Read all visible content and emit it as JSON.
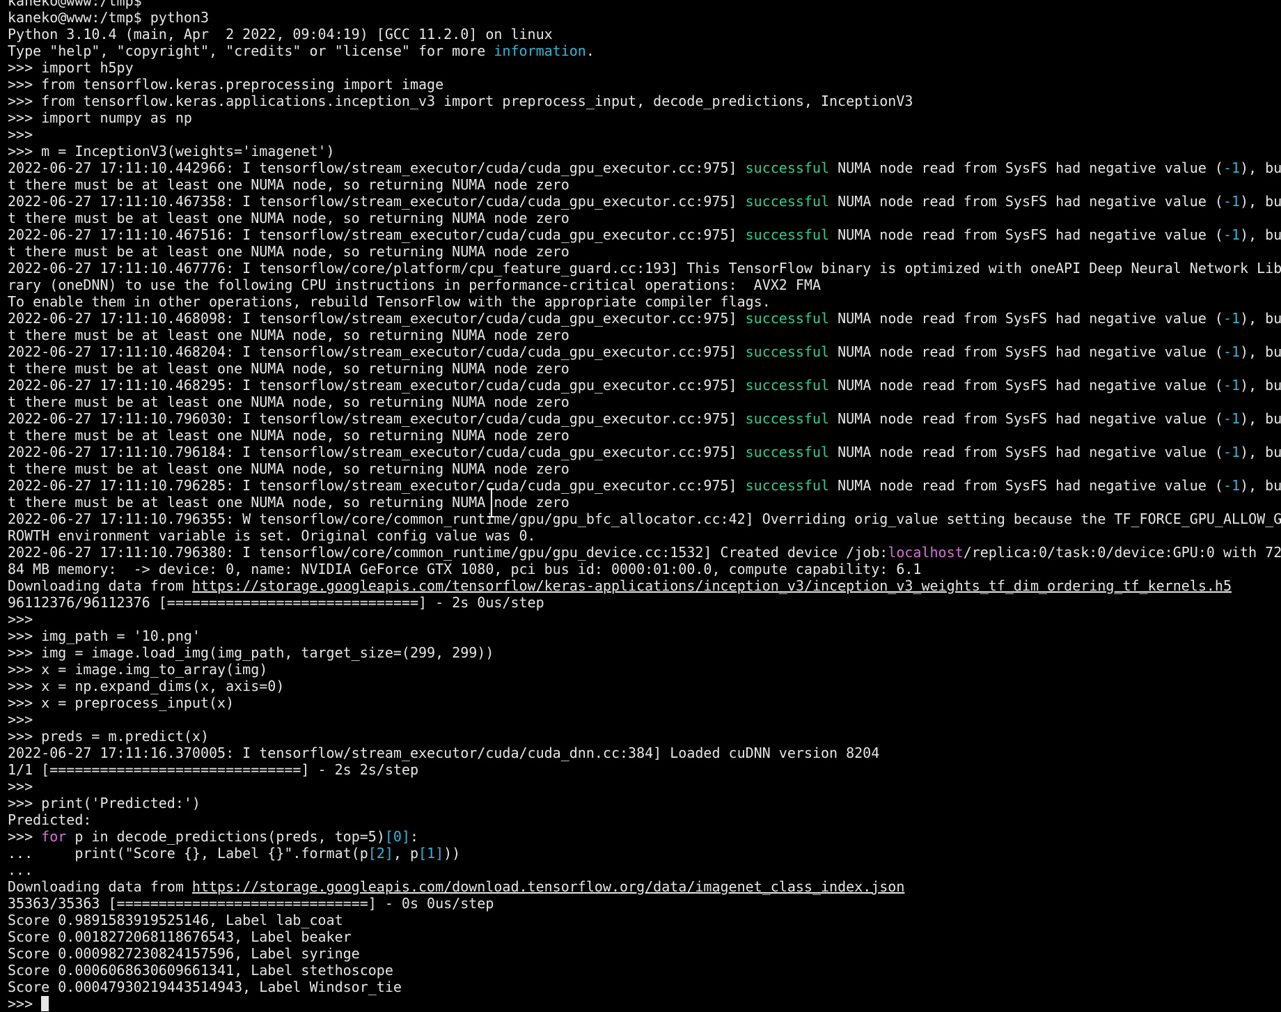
{
  "terminal": {
    "colors": {
      "background": "#000000",
      "text": "#e6e6e6",
      "success": "#23d18b",
      "number": "#29b8db",
      "keyword": "#d670d6"
    },
    "lines": [
      [
        {
          "t": "kaneko@www:/tmp$"
        }
      ],
      [
        {
          "t": "kaneko@www:/tmp$ python3"
        }
      ],
      [
        {
          "t": "Python 3.10.4 (main, Apr  2 2022, 09:04:19) [GCC 11.2.0] on linux"
        }
      ],
      [
        {
          "t": "Type \"help\", \"copyright\", \"credits\" or \"license\" for more "
        },
        {
          "t": "information",
          "s": "cyan"
        },
        {
          "t": "."
        }
      ],
      [
        {
          "t": ">>> import h5py"
        }
      ],
      [
        {
          "t": ">>> from tensorflow.keras.preprocessing import image"
        }
      ],
      [
        {
          "t": ">>> from tensorflow.keras.applications.inception_v3 import preprocess_input, decode_predictions, InceptionV3"
        }
      ],
      [
        {
          "t": ">>> import numpy as np"
        }
      ],
      [
        {
          "t": ">>>"
        }
      ],
      [
        {
          "t": ">>> m = InceptionV3(weights='imagenet')"
        }
      ],
      [
        {
          "t": "2022-06-27 17:11:10.442966: I tensorflow/stream_executor/cuda/cuda_gpu_executor.cc:975] "
        },
        {
          "t": "successful",
          "s": "green"
        },
        {
          "t": " NUMA node read from SysFS had negative value ("
        },
        {
          "t": "-1",
          "s": "cyan"
        },
        {
          "t": "), bu"
        }
      ],
      [
        {
          "t": "t there must be at least one NUMA node, so returning NUMA node zero"
        }
      ],
      [
        {
          "t": "2022-06-27 17:11:10.467358: I tensorflow/stream_executor/cuda/cuda_gpu_executor.cc:975] "
        },
        {
          "t": "successful",
          "s": "green"
        },
        {
          "t": " NUMA node read from SysFS had negative value ("
        },
        {
          "t": "-1",
          "s": "cyan"
        },
        {
          "t": "), bu"
        }
      ],
      [
        {
          "t": "t there must be at least one NUMA node, so returning NUMA node zero"
        }
      ],
      [
        {
          "t": "2022-06-27 17:11:10.467516: I tensorflow/stream_executor/cuda/cuda_gpu_executor.cc:975] "
        },
        {
          "t": "successful",
          "s": "green"
        },
        {
          "t": " NUMA node read from SysFS had negative value ("
        },
        {
          "t": "-1",
          "s": "cyan"
        },
        {
          "t": "), bu"
        }
      ],
      [
        {
          "t": "t there must be at least one NUMA node, so returning NUMA node zero"
        }
      ],
      [
        {
          "t": "2022-06-27 17:11:10.467776: I tensorflow/core/platform/cpu_feature_guard.cc:193] This TensorFlow binary is optimized with oneAPI Deep Neural Network Lib"
        }
      ],
      [
        {
          "t": "rary (oneDNN) to use the following CPU instructions in performance-critical operations:  AVX2 FMA"
        }
      ],
      [
        {
          "t": "To enable them in other operations, rebuild TensorFlow with the appropriate compiler flags."
        }
      ],
      [
        {
          "t": "2022-06-27 17:11:10.468098: I tensorflow/stream_executor/cuda/cuda_gpu_executor.cc:975] "
        },
        {
          "t": "successful",
          "s": "green"
        },
        {
          "t": " NUMA node read from SysFS had negative value ("
        },
        {
          "t": "-1",
          "s": "cyan"
        },
        {
          "t": "), bu"
        }
      ],
      [
        {
          "t": "t there must be at least one NUMA node, so returning NUMA node zero"
        }
      ],
      [
        {
          "t": "2022-06-27 17:11:10.468204: I tensorflow/stream_executor/cuda/cuda_gpu_executor.cc:975] "
        },
        {
          "t": "successful",
          "s": "green"
        },
        {
          "t": " NUMA node read from SysFS had negative value ("
        },
        {
          "t": "-1",
          "s": "cyan"
        },
        {
          "t": "), bu"
        }
      ],
      [
        {
          "t": "t there must be at least one NUMA node, so returning NUMA node zero"
        }
      ],
      [
        {
          "t": "2022-06-27 17:11:10.468295: I tensorflow/stream_executor/cuda/cuda_gpu_executor.cc:975] "
        },
        {
          "t": "successful",
          "s": "green"
        },
        {
          "t": " NUMA node read from SysFS had negative value ("
        },
        {
          "t": "-1",
          "s": "cyan"
        },
        {
          "t": "), bu"
        }
      ],
      [
        {
          "t": "t there must be at least one NUMA node, so returning NUMA node zero"
        }
      ],
      [
        {
          "t": "2022-06-27 17:11:10.796030: I tensorflow/stream_executor/cuda/cuda_gpu_executor.cc:975] "
        },
        {
          "t": "successful",
          "s": "green"
        },
        {
          "t": " NUMA node read from SysFS had negative value ("
        },
        {
          "t": "-1",
          "s": "cyan"
        },
        {
          "t": "), bu"
        }
      ],
      [
        {
          "t": "t there must be at least one NUMA node, so returning NUMA node zero"
        }
      ],
      [
        {
          "t": "2022-06-27 17:11:10.796184: I tensorflow/stream_executor/cuda/cuda_gpu_executor.cc:975] "
        },
        {
          "t": "successful",
          "s": "green"
        },
        {
          "t": " NUMA node read from SysFS had negative value ("
        },
        {
          "t": "-1",
          "s": "cyan"
        },
        {
          "t": "), bu"
        }
      ],
      [
        {
          "t": "t there must be at least one NUMA node, so returning NUMA node zero"
        }
      ],
      [
        {
          "t": "2022-06-27 17:11:10.796285: I tensorflow/stream_executor/cuda/cuda_gpu_executor.cc:975] "
        },
        {
          "t": "successful",
          "s": "green"
        },
        {
          "t": " NUMA node read from SysFS had negative value ("
        },
        {
          "t": "-1",
          "s": "cyan"
        },
        {
          "t": "), bu"
        }
      ],
      [
        {
          "t": "t there must be at least one NUMA node, so returning NUMA node zero"
        }
      ],
      [
        {
          "t": "2022-06-27 17:11:10.796355: W tensorflow/core/common_runtime/gpu/gpu_bfc_allocator.cc:42] Overriding orig_value setting because the TF_FORCE_GPU_ALLOW_G"
        }
      ],
      [
        {
          "t": "ROWTH environment variable is set. Original config value was 0."
        }
      ],
      [
        {
          "t": "2022-06-27 17:11:10.796380: I tensorflow/core/common_runtime/gpu/gpu_device.cc:1532] Created device /job:"
        },
        {
          "t": "localhost",
          "s": "magenta"
        },
        {
          "t": "/replica:0/task:0/device:GPU:0 with 72"
        }
      ],
      [
        {
          "t": "84 MB memory:  -> device: 0, name: NVIDIA GeForce GTX 1080, pci bus id: 0000:01:00.0, compute capability: 6.1"
        }
      ],
      [
        {
          "t": "Downloading data from "
        },
        {
          "t": "https://storage.googleapis.com/tensorflow/keras-applications/inception_v3/inception_v3_weights_tf_dim_ordering_tf_kernels.h5",
          "s": "url"
        }
      ],
      [
        {
          "t": "96112376/96112376 [==============================] - 2s 0us/step"
        }
      ],
      [
        {
          "t": ">>>"
        }
      ],
      [
        {
          "t": ">>> img_path = '10.png'"
        }
      ],
      [
        {
          "t": ">>> img = image.load_img(img_path, target_size=(299, 299))"
        }
      ],
      [
        {
          "t": ">>> x = image.img_to_array(img)"
        }
      ],
      [
        {
          "t": ">>> x = np.expand_dims(x, axis=0)"
        }
      ],
      [
        {
          "t": ">>> x = preprocess_input(x)"
        }
      ],
      [
        {
          "t": ">>>"
        }
      ],
      [
        {
          "t": ">>> preds = m.predict(x)"
        }
      ],
      [
        {
          "t": "2022-06-27 17:11:16.370005: I tensorflow/stream_executor/cuda/cuda_dnn.cc:384] Loaded cuDNN version 8204"
        }
      ],
      [
        {
          "t": "1/1 [==============================] - 2s 2s/step"
        }
      ],
      [
        {
          "t": ">>>"
        }
      ],
      [
        {
          "t": ">>> print('Predicted:')"
        }
      ],
      [
        {
          "t": "Predicted:"
        }
      ],
      [
        {
          "t": ">>> "
        },
        {
          "t": "for",
          "s": "magenta"
        },
        {
          "t": " p in decode_predictions(preds, top=5)"
        },
        {
          "t": "[0]",
          "s": "cyan"
        },
        {
          "t": ":"
        }
      ],
      [
        {
          "t": "...     print(\"Score {}, Label {}\".format(p"
        },
        {
          "t": "[2]",
          "s": "cyan"
        },
        {
          "t": ", p"
        },
        {
          "t": "[1]",
          "s": "cyan"
        },
        {
          "t": "))"
        }
      ],
      [
        {
          "t": "..."
        }
      ],
      [
        {
          "t": "Downloading data from "
        },
        {
          "t": "https://storage.googleapis.com/download.tensorflow.org/data/imagenet_class_index.json",
          "s": "url"
        }
      ],
      [
        {
          "t": "35363/35363 [==============================] - 0s 0us/step"
        }
      ],
      [
        {
          "t": "Score 0.9891583919525146, Label lab_coat"
        }
      ],
      [
        {
          "t": "Score 0.0018272068118676543, Label beaker"
        }
      ],
      [
        {
          "t": "Score 0.0009827230824157596, Label syringe"
        }
      ],
      [
        {
          "t": "Score 0.0006068630609661341, Label stethoscope"
        }
      ],
      [
        {
          "t": "Score 0.00047930219443514943, Label Windsor_tie"
        }
      ],
      [
        {
          "t": ">>> "
        }
      ]
    ]
  }
}
